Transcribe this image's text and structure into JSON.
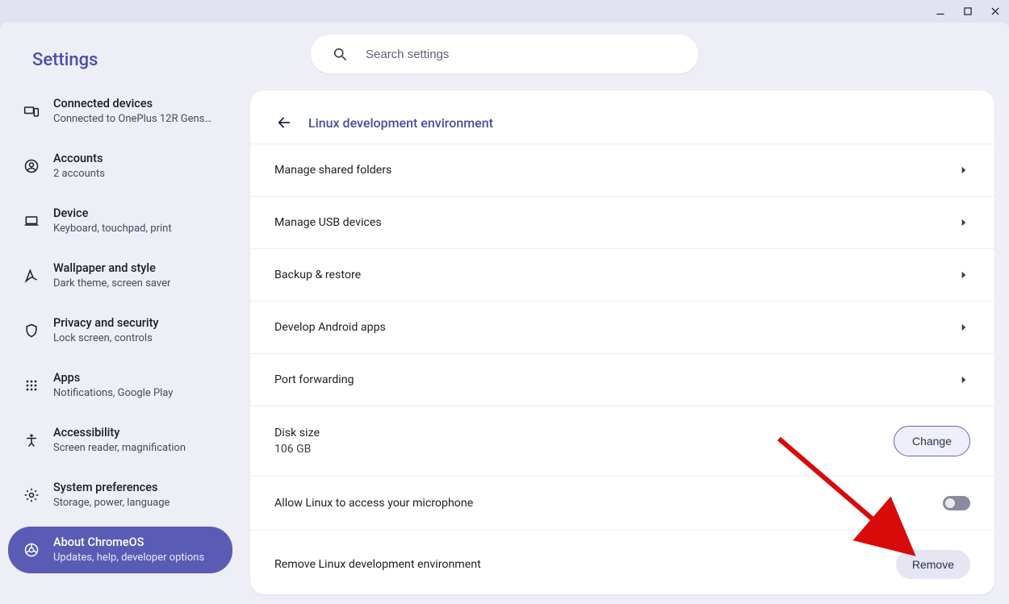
{
  "window_controls": {
    "min": "minimize",
    "max": "maximize",
    "close": "close"
  },
  "app": {
    "title": "Settings",
    "search_placeholder": "Search settings"
  },
  "nav": {
    "items": [
      {
        "key": "connected-devices",
        "label": "Connected devices",
        "sub": "Connected to OnePlus 12R Gens…",
        "icon": "devices"
      },
      {
        "key": "accounts",
        "label": "Accounts",
        "sub": "2 accounts",
        "icon": "account"
      },
      {
        "key": "device",
        "label": "Device",
        "sub": "Keyboard, touchpad, print",
        "icon": "laptop"
      },
      {
        "key": "wallpaper",
        "label": "Wallpaper and style",
        "sub": "Dark theme, screen saver",
        "icon": "style"
      },
      {
        "key": "privacy",
        "label": "Privacy and security",
        "sub": "Lock screen, controls",
        "icon": "shield"
      },
      {
        "key": "apps",
        "label": "Apps",
        "sub": "Notifications, Google Play",
        "icon": "apps"
      },
      {
        "key": "accessibility",
        "label": "Accessibility",
        "sub": "Screen reader, magnification",
        "icon": "accessibility"
      },
      {
        "key": "system-prefs",
        "label": "System preferences",
        "sub": "Storage, power, language",
        "icon": "gear"
      },
      {
        "key": "about",
        "label": "About ChromeOS",
        "sub": "Updates, help, developer options",
        "icon": "chrome",
        "selected": true
      }
    ]
  },
  "page": {
    "title": "Linux development environment",
    "rows": {
      "shared_folders": "Manage shared folders",
      "usb": "Manage USB devices",
      "backup": "Backup & restore",
      "android": "Develop Android apps",
      "port": "Port forwarding",
      "disk_label": "Disk size",
      "disk_value": "106 GB",
      "disk_change": "Change",
      "mic": "Allow Linux to access your microphone",
      "remove_label": "Remove Linux development environment",
      "remove_btn": "Remove"
    }
  },
  "annotation": {
    "arrow_target": "remove-button"
  }
}
